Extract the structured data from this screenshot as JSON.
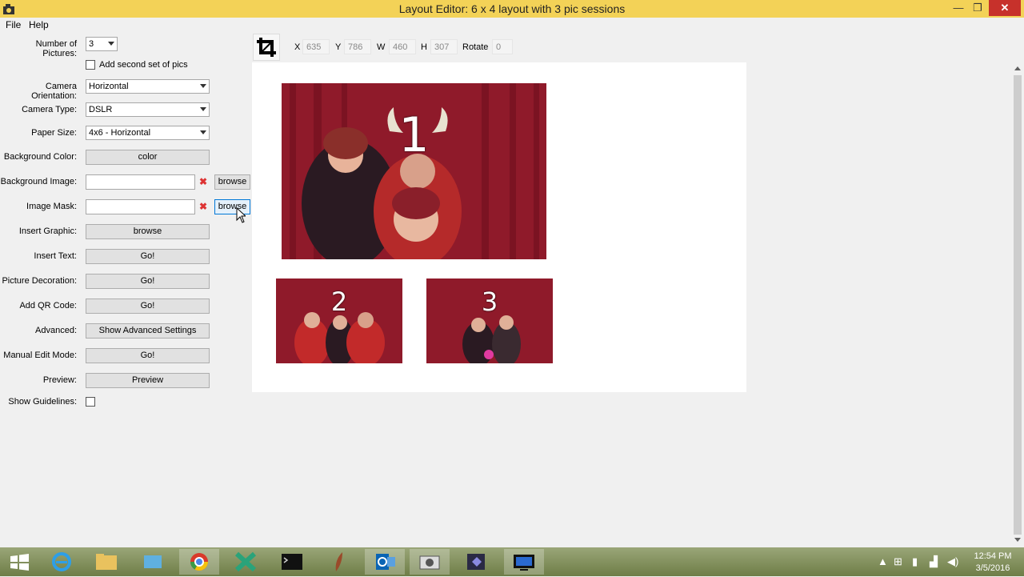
{
  "window": {
    "title": "Layout Editor: 6 x 4 layout with 3 pic sessions",
    "minimize": "—",
    "maximize": "❐",
    "close": "✕"
  },
  "menu": {
    "file": "File",
    "help": "Help"
  },
  "form": {
    "num_pictures": {
      "label": "Number of Pictures:",
      "value": "3"
    },
    "second_set": {
      "label": "Add second set of pics",
      "checked": false
    },
    "camera_orientation": {
      "label": "Camera Orientation:",
      "value": "Horizontal"
    },
    "camera_type": {
      "label": "Camera Type:",
      "value": "DSLR"
    },
    "paper_size": {
      "label": "Paper Size:",
      "value": "4x6 - Horizontal"
    },
    "background_color": {
      "label": "Background Color:",
      "button": "color"
    },
    "background_image": {
      "label": "Background Image:",
      "value": "",
      "clear": "✖",
      "button": "browse"
    },
    "image_mask": {
      "label": "Image Mask:",
      "value": "",
      "clear": "✖",
      "button": "browse"
    },
    "insert_graphic": {
      "label": "Insert Graphic:",
      "button": "browse"
    },
    "insert_text": {
      "label": "Insert Text:",
      "button": "Go!"
    },
    "picture_decoration": {
      "label": "Picture Decoration:",
      "button": "Go!"
    },
    "add_qr_code": {
      "label": "Add QR Code:",
      "button": "Go!"
    },
    "advanced": {
      "label": "Advanced:",
      "button": "Show Advanced Settings"
    },
    "manual_edit": {
      "label": "Manual Edit Mode:",
      "button": "Go!"
    },
    "preview": {
      "label": "Preview:",
      "button": "Preview"
    },
    "show_guidelines": {
      "label": "Show Guidelines:",
      "checked": false
    }
  },
  "toolbar": {
    "x_label": "X",
    "x_value": "635",
    "y_label": "Y",
    "y_value": "786",
    "w_label": "W",
    "w_value": "460",
    "h_label": "H",
    "h_value": "307",
    "rotate_label": "Rotate",
    "rotate_value": "0"
  },
  "canvas": {
    "photos": [
      {
        "number": "1"
      },
      {
        "number": "2"
      },
      {
        "number": "3"
      }
    ]
  },
  "taskbar": {
    "time": "12:54 PM",
    "date": "3/5/2016"
  },
  "colors": {
    "titlebar": "#f3d257",
    "close": "#c7312b",
    "curtain": "#8f1a2a"
  }
}
